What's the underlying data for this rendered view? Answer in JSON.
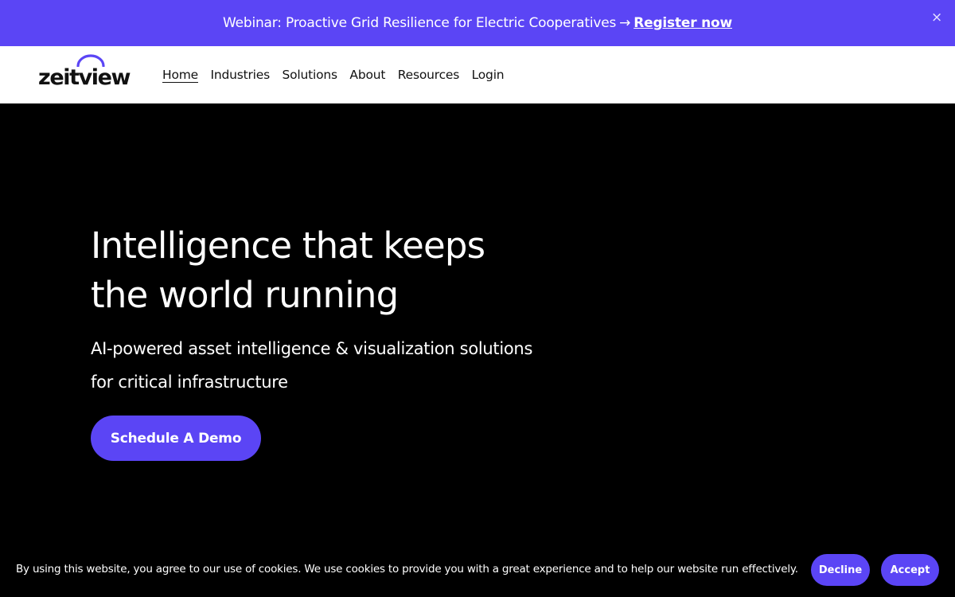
{
  "announcement": {
    "text": "Webinar: Proactive Grid Resilience for Electric Cooperatives",
    "arrow": "→",
    "link": "Register now",
    "close_icon": "×"
  },
  "header": {
    "logo": "zeitview",
    "nav": [
      {
        "label": "Home",
        "active": true
      },
      {
        "label": "Industries"
      },
      {
        "label": "Solutions"
      },
      {
        "label": "About"
      },
      {
        "label": "Resources"
      },
      {
        "label": "Login"
      }
    ]
  },
  "hero": {
    "title": "Intelligence that keeps the world running",
    "subtitle": "AI-powered asset intelligence & visualization solutions for critical infrastructure",
    "cta": "Schedule A Demo"
  },
  "cookie_banner": {
    "message": "By using this website, you agree to our use of cookies. We use cookies to provide you with a great experience and to help our website run effectively.",
    "decline": "Decline",
    "accept": "Accept"
  },
  "colors": {
    "accent": "#5b45f5",
    "background": "#000000",
    "nav_background": "#ffffff"
  }
}
